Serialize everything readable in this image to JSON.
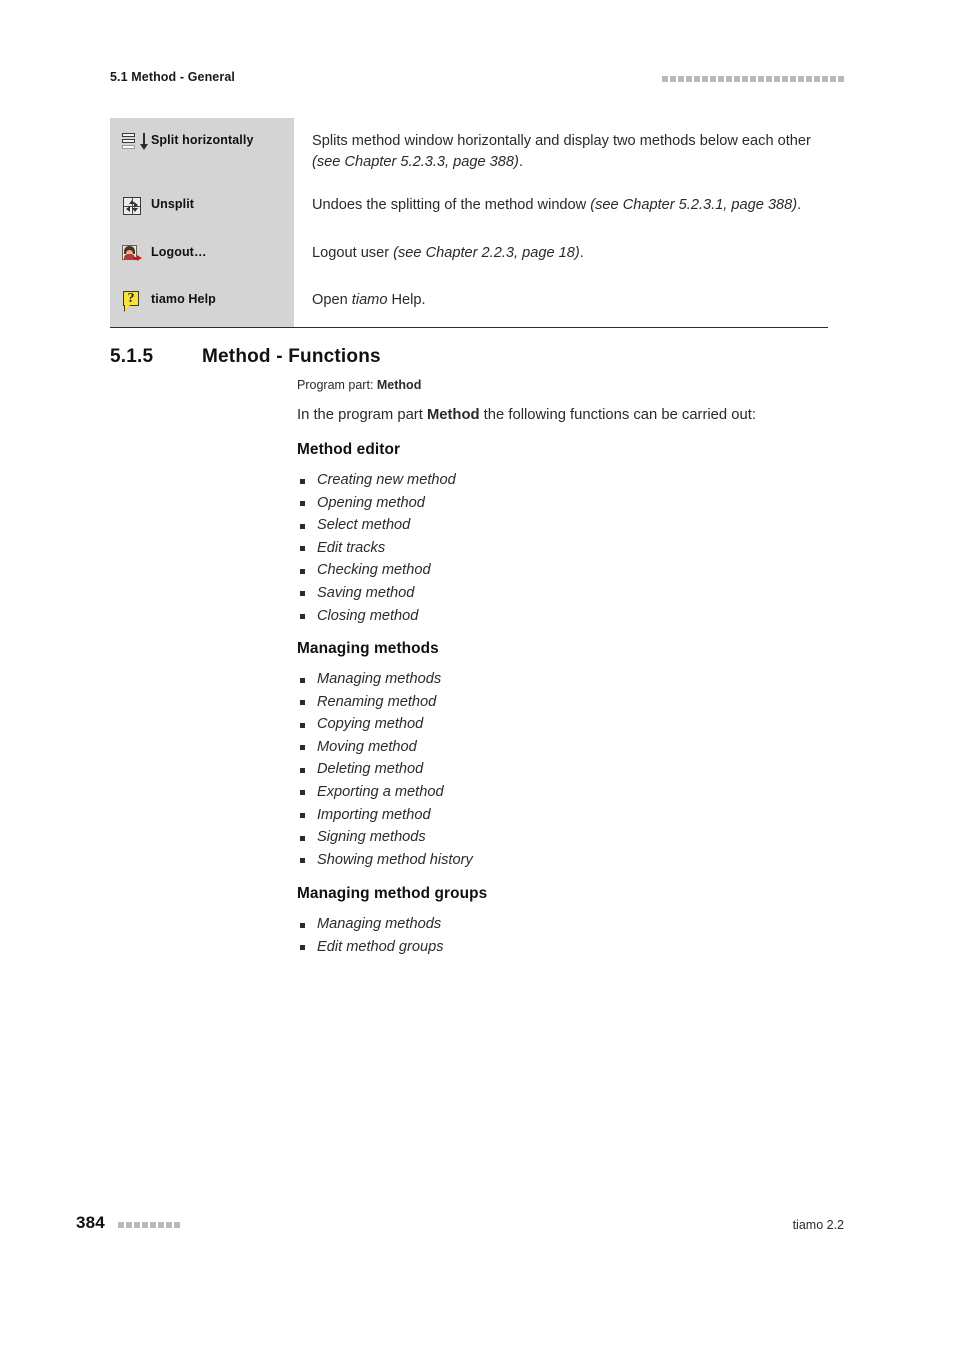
{
  "page": {
    "running_head": "5.1 Method - General",
    "footer_page_number": "384",
    "footer_right": "tiamo 2.2",
    "header_decoration_squares": 23,
    "footer_decoration_squares": 8,
    "decoration_square_color": "#b9b9b9",
    "table_left_column_bg": "#d4d4d4"
  },
  "icon_table": {
    "rows": [
      {
        "icon": "split-horizontally-icon",
        "label": "Split horizontally",
        "description_plain": "Splits method window horizontally and display two methods below each other (see Chapter 5.2.3.3, page 388).",
        "description_lead": "Splits method window horizontally and display two methods below each other ",
        "description_ref": "(see Chapter 5.2.3.3, page 388)",
        "description_tail": "."
      },
      {
        "icon": "unsplit-icon",
        "label": "Unsplit",
        "description_plain": "Undoes the splitting of the method window (see Chapter 5.2.3.1, page 388).",
        "description_lead": "Undoes the splitting of the method window ",
        "description_ref": "(see Chapter 5.2.3.1, page 388)",
        "description_tail": "."
      },
      {
        "icon": "logout-icon",
        "label": "Logout…",
        "description_plain": "Logout user (see Chapter 2.2.3, page 18).",
        "description_lead": "Logout user ",
        "description_ref": "(see Chapter 2.2.3, page 18)",
        "description_tail": "."
      },
      {
        "icon": "tiamo-help-icon",
        "label": "tiamo Help",
        "description_plain": "Open tiamo Help.",
        "description_lead": "Open ",
        "description_ref": "tiamo",
        "description_tail": " Help."
      }
    ]
  },
  "section": {
    "number": "5.1.5",
    "title": "Method - Functions",
    "program_part_label": "Program part: ",
    "program_part_value": "Method",
    "intro_lead": "In the program part ",
    "intro_bold": "Method",
    "intro_tail": " the following functions can be carried out:"
  },
  "blocks": [
    {
      "title": "Method editor",
      "items": [
        "Creating new method",
        "Opening method",
        "Select method",
        "Edit tracks",
        "Checking method",
        "Saving method",
        "Closing method"
      ]
    },
    {
      "title": "Managing methods",
      "items": [
        "Managing methods",
        "Renaming method",
        "Copying method",
        "Moving method",
        "Deleting method",
        "Exporting a method",
        "Importing method",
        "Signing methods",
        "Showing method history"
      ]
    },
    {
      "title": "Managing method groups",
      "items": [
        "Managing methods",
        "Edit method groups"
      ]
    }
  ]
}
